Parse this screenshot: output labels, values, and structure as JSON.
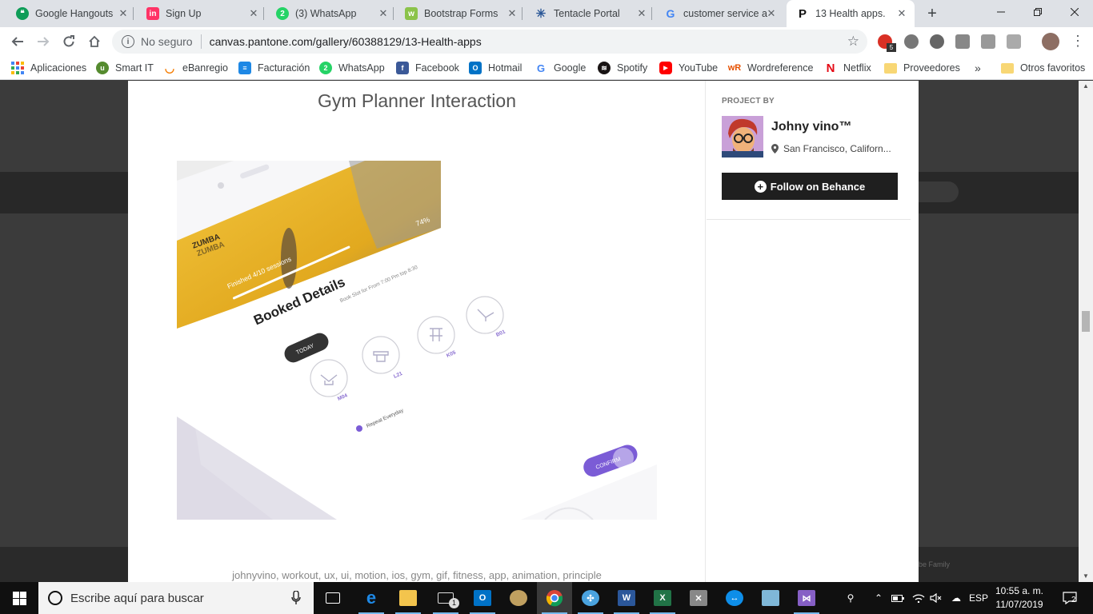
{
  "browser": {
    "tabs": [
      {
        "title": "Google Hangouts",
        "icon": "hangouts-icon",
        "color": "#0f9d58",
        "glyph": "“"
      },
      {
        "title": "Sign Up",
        "icon": "invision-icon",
        "color": "#ff3366",
        "glyph": "in"
      },
      {
        "title": "(3) WhatsApp",
        "icon": "whatsapp-icon",
        "color": "#25d366",
        "glyph": "2"
      },
      {
        "title": "Bootstrap Forms",
        "icon": "w3schools-icon",
        "color": "#8bc34a",
        "glyph": "w"
      },
      {
        "title": "Tentacle Portal",
        "icon": "tentacle-icon",
        "color": "#2b5797",
        "glyph": "✳"
      },
      {
        "title": "customer service a",
        "icon": "google-icon",
        "color": "#4285f4",
        "glyph": "G"
      },
      {
        "title": "13 Health apps.",
        "icon": "pantone-icon",
        "color": "#111111",
        "glyph": "P"
      }
    ],
    "new_tab_glyph": "+",
    "omnibox": {
      "security_label": "No seguro",
      "url": "canvas.pantone.com/gallery/60388129/13-Health-apps"
    },
    "extension_badge": "5",
    "bookmarks": [
      {
        "label": "Aplicaciones",
        "icon": "apps-grid-icon",
        "color": "#4285f4"
      },
      {
        "label": "Smart IT",
        "icon": "smart-it-icon",
        "color": "#558b2f"
      },
      {
        "label": "eBanregio",
        "icon": "ebanregio-icon",
        "color": "#f57c00"
      },
      {
        "label": "Facturación",
        "icon": "invoice-icon",
        "color": "#1e88e5"
      },
      {
        "label": "WhatsApp",
        "icon": "whatsapp-icon",
        "color": "#25d366"
      },
      {
        "label": "Facebook",
        "icon": "facebook-icon",
        "color": "#3b5998"
      },
      {
        "label": "Hotmail",
        "icon": "outlook-icon",
        "color": "#0072c6"
      },
      {
        "label": "Google",
        "icon": "google-icon",
        "color": "#4285f4"
      },
      {
        "label": "Spotify",
        "icon": "spotify-icon",
        "color": "#191414"
      },
      {
        "label": "YouTube",
        "icon": "youtube-icon",
        "color": "#ff0000"
      },
      {
        "label": "Wordreference",
        "icon": "wordreference-icon",
        "color": "#e65100"
      },
      {
        "label": "Netflix",
        "icon": "netflix-icon",
        "color": "#e50914"
      },
      {
        "label": "Proveedores",
        "icon": "folder-icon",
        "color": "#f8d775"
      }
    ],
    "more_bookmarks_glyph": "»",
    "other_bookmarks": "Otros favoritos"
  },
  "project": {
    "title": "Gym Planner Interaction",
    "tags": "johnyvino, workout, ux, ui, motion, ios, gym, gif, fitness, app, animation, principle",
    "project_by_label": "PROJECT BY",
    "owner_name": "Johny vino™",
    "owner_location": "San Francisco, Californ...",
    "follow_label": "Follow on Behance",
    "background_footer": "be Family"
  },
  "mockup": {
    "class_name": "ZUMBA",
    "class_name_shadow": "ZUMBA",
    "sessions": "Finished 4/10 sessions",
    "percent": "74%",
    "heading": "Booked Details",
    "slot": "Book Slot for From 7:00 Pm top 8:30",
    "today": "TODAY",
    "machines": [
      "M04",
      "L21",
      "K05",
      "B01"
    ],
    "repeat": "Repeat Everyday",
    "confirm": "CONFIRM"
  },
  "taskbar": {
    "search_placeholder": "Escribe aquí para buscar",
    "language": "ESP",
    "time": "10:55 a. m.",
    "date": "11/07/2019",
    "notifications": "2",
    "mail_badge": "1",
    "apps": [
      {
        "name": "task-view-icon",
        "color": "#ffffff"
      },
      {
        "name": "edge-icon",
        "color": "#1e88e5"
      },
      {
        "name": "file-explorer-icon",
        "color": "#f3c44d"
      },
      {
        "name": "mail-icon",
        "color": "#dddddd"
      },
      {
        "name": "outlook-icon",
        "color": "#0072c6"
      },
      {
        "name": "paint-icon",
        "color": "#c0a060"
      },
      {
        "name": "chrome-icon",
        "color": "#db4437"
      },
      {
        "name": "app-icon",
        "color": "#4aa3df"
      },
      {
        "name": "word-icon",
        "color": "#2b579a"
      },
      {
        "name": "excel-icon",
        "color": "#217346"
      },
      {
        "name": "tools-icon",
        "color": "#888888"
      },
      {
        "name": "teamviewer-icon",
        "color": "#0e8ee9"
      },
      {
        "name": "notes-icon",
        "color": "#7fb7d8"
      },
      {
        "name": "visual-studio-icon",
        "color": "#865fc5"
      }
    ]
  }
}
